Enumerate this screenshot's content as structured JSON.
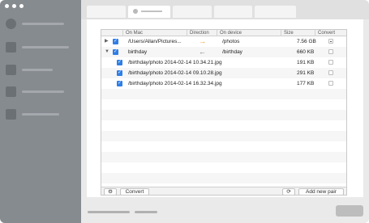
{
  "table": {
    "headers": {
      "on_mac": "On Mac",
      "direction": "Direction",
      "on_device": "On device",
      "size": "Size",
      "convert": "Convert"
    },
    "rows": [
      {
        "mac_path": "/Users/Allan/Pictures...",
        "direction": "→",
        "device_path": "/photos",
        "size": "7.56 GB",
        "expanded": false,
        "convert": "mixed"
      },
      {
        "mac_path": "birthday",
        "direction": "←",
        "device_path": "/birthday",
        "size": "660 KB",
        "expanded": true,
        "convert": "off"
      },
      {
        "mac_path": "/birthday/photo 2014-02-14 10.34.21.jpg",
        "direction": "",
        "device_path": "",
        "size": "191 KB",
        "child": true,
        "convert": "off"
      },
      {
        "mac_path": "/birthday/photo 2014-02-14 09.10.28.jpg",
        "direction": "",
        "device_path": "",
        "size": "291 KB",
        "child": true,
        "convert": "off"
      },
      {
        "mac_path": "/birthday/photo 2014-02-14 16.32.34.jpg",
        "direction": "",
        "device_path": "",
        "size": "177 KB",
        "child": true,
        "convert": "off"
      }
    ]
  },
  "toolbar": {
    "settings_icon": "gear-icon",
    "convert_label": "Convert",
    "refresh_icon": "refresh-icon",
    "add_pair_label": "Add new pair"
  },
  "colors": {
    "sidebar": "#868b90",
    "checkbox": "#2f7ee6",
    "arrow_to_device": "#f0a020",
    "arrow_to_mac": "#777777"
  }
}
